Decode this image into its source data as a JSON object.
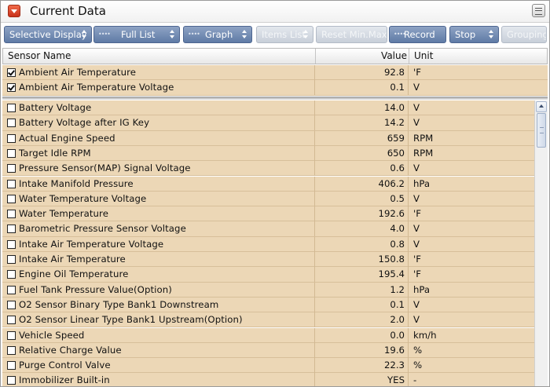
{
  "window": {
    "title": "Current Data"
  },
  "toolbar": {
    "buttons": [
      {
        "label": "Selective Display",
        "enabled": true
      },
      {
        "label": "Full List",
        "enabled": true
      },
      {
        "label": "Graph",
        "enabled": true
      },
      {
        "label": "Items List",
        "enabled": false
      },
      {
        "label": "Reset Min.Max.",
        "enabled": false
      },
      {
        "label": "Record",
        "enabled": true
      },
      {
        "label": "Stop",
        "enabled": true
      },
      {
        "label": "Grouping",
        "enabled": false
      }
    ]
  },
  "table": {
    "headers": {
      "name": "Sensor Name",
      "value": "Value",
      "unit": "Unit"
    },
    "pinned": [
      {
        "name": "Ambient Air Temperature",
        "value": "92.8",
        "unit": "'F",
        "checked": true
      },
      {
        "name": "Ambient Air Temperature Voltage",
        "value": "0.1",
        "unit": "V",
        "checked": true
      }
    ],
    "rows": [
      {
        "name": "Battery Voltage",
        "value": "14.0",
        "unit": "V",
        "checked": false
      },
      {
        "name": "Battery Voltage after IG Key",
        "value": "14.2",
        "unit": "V",
        "checked": false
      },
      {
        "name": "Actual Engine Speed",
        "value": "659",
        "unit": "RPM",
        "checked": false
      },
      {
        "name": "Target Idle RPM",
        "value": "650",
        "unit": "RPM",
        "checked": false
      },
      {
        "name": "Pressure Sensor(MAP) Signal Voltage",
        "value": "0.6",
        "unit": "V",
        "checked": false
      },
      {
        "name": "Intake Manifold Pressure",
        "value": "406.2",
        "unit": "hPa",
        "checked": false
      },
      {
        "name": "Water Temperature Voltage",
        "value": "0.5",
        "unit": "V",
        "checked": false
      },
      {
        "name": "Water Temperature",
        "value": "192.6",
        "unit": "'F",
        "checked": false
      },
      {
        "name": "Barometric Pressure Sensor Voltage",
        "value": "4.0",
        "unit": "V",
        "checked": false
      },
      {
        "name": "Intake Air Temperature Voltage",
        "value": "0.8",
        "unit": "V",
        "checked": false
      },
      {
        "name": "Intake Air Temperature",
        "value": "150.8",
        "unit": "'F",
        "checked": false
      },
      {
        "name": "Engine Oil Temperature",
        "value": "195.4",
        "unit": "'F",
        "checked": false
      },
      {
        "name": "Fuel Tank Pressure Value(Option)",
        "value": "1.2",
        "unit": "hPa",
        "checked": false
      },
      {
        "name": "O2 Sensor Binary Type Bank1 Downstream",
        "value": "0.1",
        "unit": "V",
        "checked": false
      },
      {
        "name": "O2 Sensor Linear Type Bank1 Upstream(Option)",
        "value": "2.0",
        "unit": "V",
        "checked": false
      },
      {
        "name": "Vehicle Speed",
        "value": "0.0",
        "unit": "km/h",
        "checked": false
      },
      {
        "name": "Relative Charge Value",
        "value": "19.6",
        "unit": "%",
        "checked": false
      },
      {
        "name": "Purge Control Valve",
        "value": "22.3",
        "unit": "%",
        "checked": false
      },
      {
        "name": "Immobilizer Built-in",
        "value": "YES",
        "unit": "-",
        "checked": false
      }
    ]
  },
  "colors": {
    "row_bg": "#ecd7b6",
    "toolbar_button": "#6f88b2",
    "title_toggle": "#d9462a"
  },
  "icons": {
    "collapse": "chevron-down-icon",
    "window_menu": "window-menu-icon"
  }
}
